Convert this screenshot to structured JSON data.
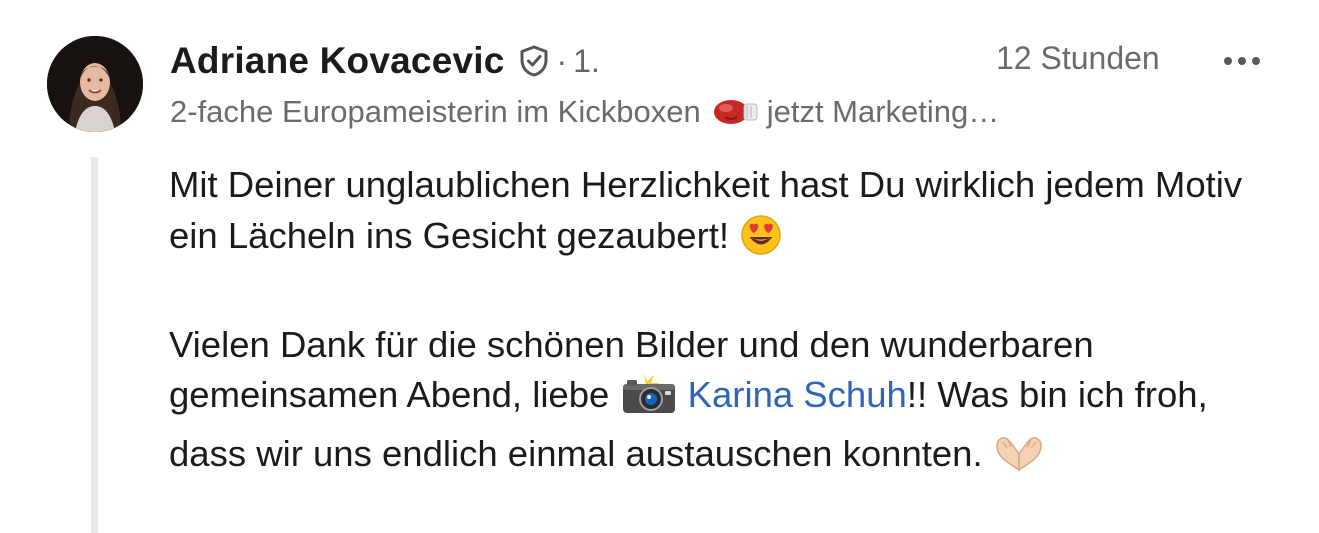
{
  "comment": {
    "author": {
      "name": "Adriane Kovacevic",
      "verified_icon": "shield-check-icon",
      "degree_separator": "·",
      "degree": "1.",
      "headline_prefix": "2-fache Europameisterin im Kickboxen",
      "headline_icon": "boxing-glove-icon",
      "headline_suffix": "jetzt Marketing…"
    },
    "timestamp": "12 Stunden",
    "more_icon": "more-horizontal-icon",
    "body": {
      "paragraph1": "Mit Deiner unglaublichen Herzlichkeit hast Du wirklich jedem Motiv ein Lächeln ins Gesicht gezaubert!",
      "paragraph1_emoji": "heart-eyes-emoji",
      "paragraph2_prefix": "Vielen Dank für die schönen Bilder und den wunderbaren gemeinsamen Abend, liebe",
      "paragraph2_emoji": "camera-flash-emoji",
      "mention": "Karina Schuh",
      "paragraph2_suffix": "!! Was bin ich froh, dass wir uns endlich einmal austauschen konnten.",
      "paragraph2_end_emoji": "heart-hands-emoji"
    },
    "colors": {
      "mention": "#2d66b8",
      "meta_text": "#6b6b6b",
      "thread_line": "#e9e8e4"
    }
  }
}
